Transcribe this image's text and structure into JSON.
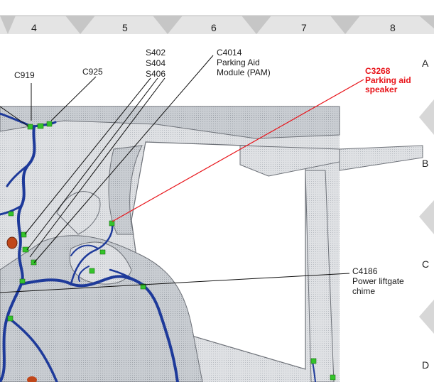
{
  "ruler": {
    "columns": [
      "4",
      "5",
      "6",
      "7",
      "8"
    ],
    "rows": [
      "A",
      "B",
      "C",
      "D"
    ]
  },
  "callouts": {
    "c919": "C919",
    "c925": "C925",
    "splices": [
      "S402",
      "S404",
      "S406"
    ],
    "pam": [
      "C4014",
      "Parking Aid",
      "Module (PAM)"
    ],
    "speaker": [
      "C3268",
      "Parking aid",
      "speaker"
    ],
    "chime": [
      "C4186",
      "Power liftgate",
      "chime"
    ]
  },
  "colors": {
    "harness": "#1e3a9a",
    "connector": "#34c42a",
    "callout_red": "#e8141a",
    "leader": "#111111",
    "ruler_band": "#e4e4e4"
  }
}
